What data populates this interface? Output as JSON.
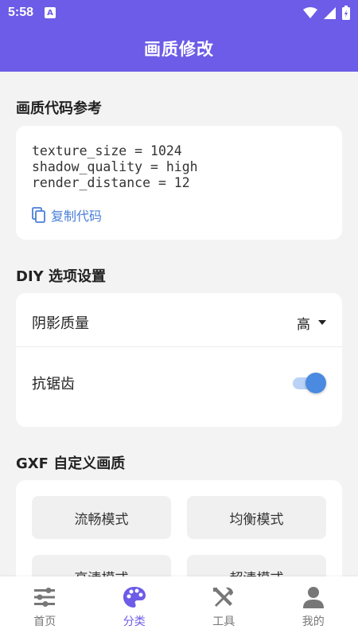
{
  "status_bar": {
    "time": "5:58",
    "notification_badge": "A"
  },
  "app_bar": {
    "title": "画质修改"
  },
  "code_section": {
    "title": "画质代码参考",
    "lines": [
      "texture_size = 1024",
      "shadow_quality = high",
      "render_distance = 12"
    ],
    "copy_label": "复制代码"
  },
  "diy_section": {
    "title": "DIY 选项设置",
    "shadow_label": "阴影质量",
    "shadow_value": "高",
    "antialias_label": "抗锯齿",
    "antialias_enabled": true
  },
  "gxf_section": {
    "title": "GXF 自定义画质",
    "modes": [
      "流畅模式",
      "均衡模式",
      "高清模式",
      "超清模式"
    ]
  },
  "bottom_nav": {
    "items": [
      {
        "label": "首页",
        "icon": "sliders-icon"
      },
      {
        "label": "分类",
        "icon": "palette-icon"
      },
      {
        "label": "工具",
        "icon": "tools-icon"
      },
      {
        "label": "我的",
        "icon": "person-icon"
      }
    ],
    "active_index": 1
  },
  "colors": {
    "primary": "#6c5ce7",
    "link": "#4a7fd9",
    "toggle_on": "#4a8ae0",
    "nav_inactive": "#777777"
  }
}
